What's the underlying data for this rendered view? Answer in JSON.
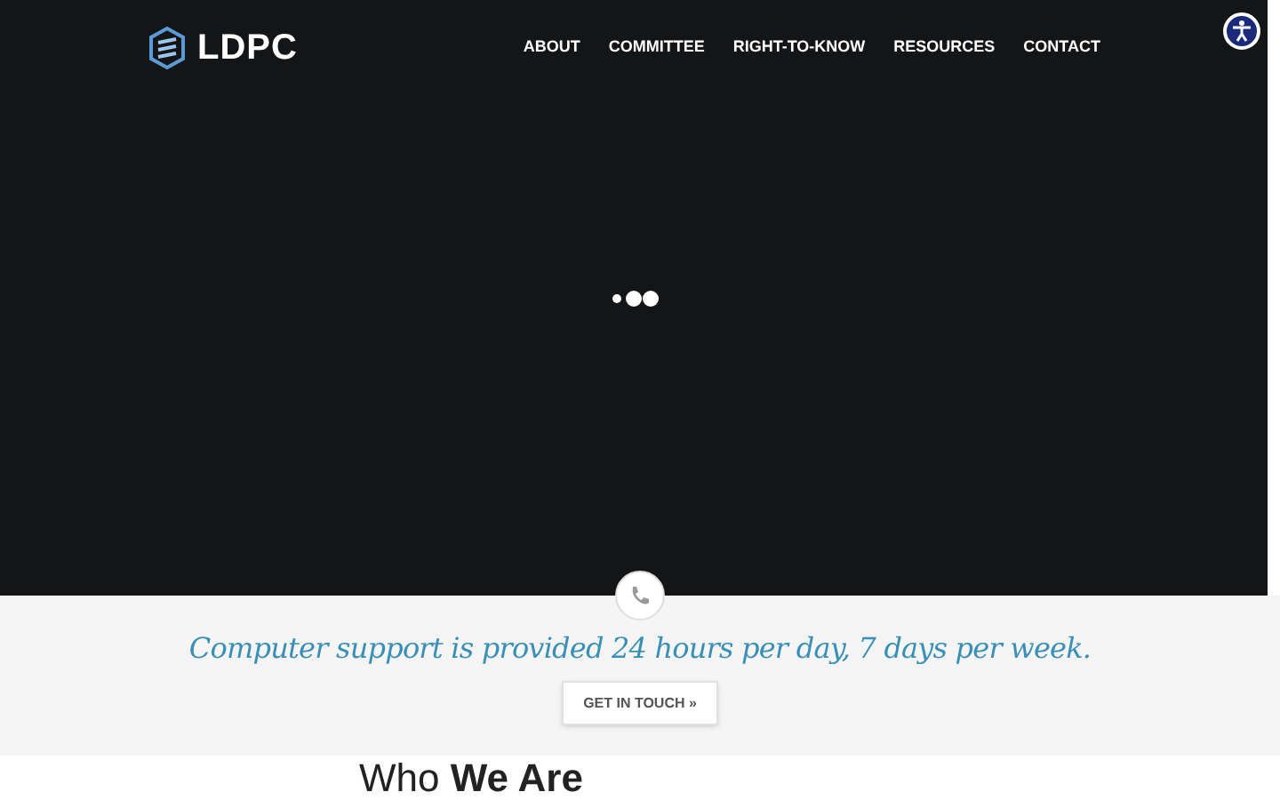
{
  "header": {
    "logo": "LDPC",
    "nav": [
      {
        "label": "ABOUT"
      },
      {
        "label": "COMMITTEE"
      },
      {
        "label": "RIGHT-TO-KNOW"
      },
      {
        "label": "RESOURCES"
      },
      {
        "label": "CONTACT"
      }
    ]
  },
  "banner": {
    "text": "Computer support is provided 24 hours per day, 7 days per week.",
    "button": "GET IN TOUCH »"
  },
  "section": {
    "heading": "Who **We Are**"
  }
}
